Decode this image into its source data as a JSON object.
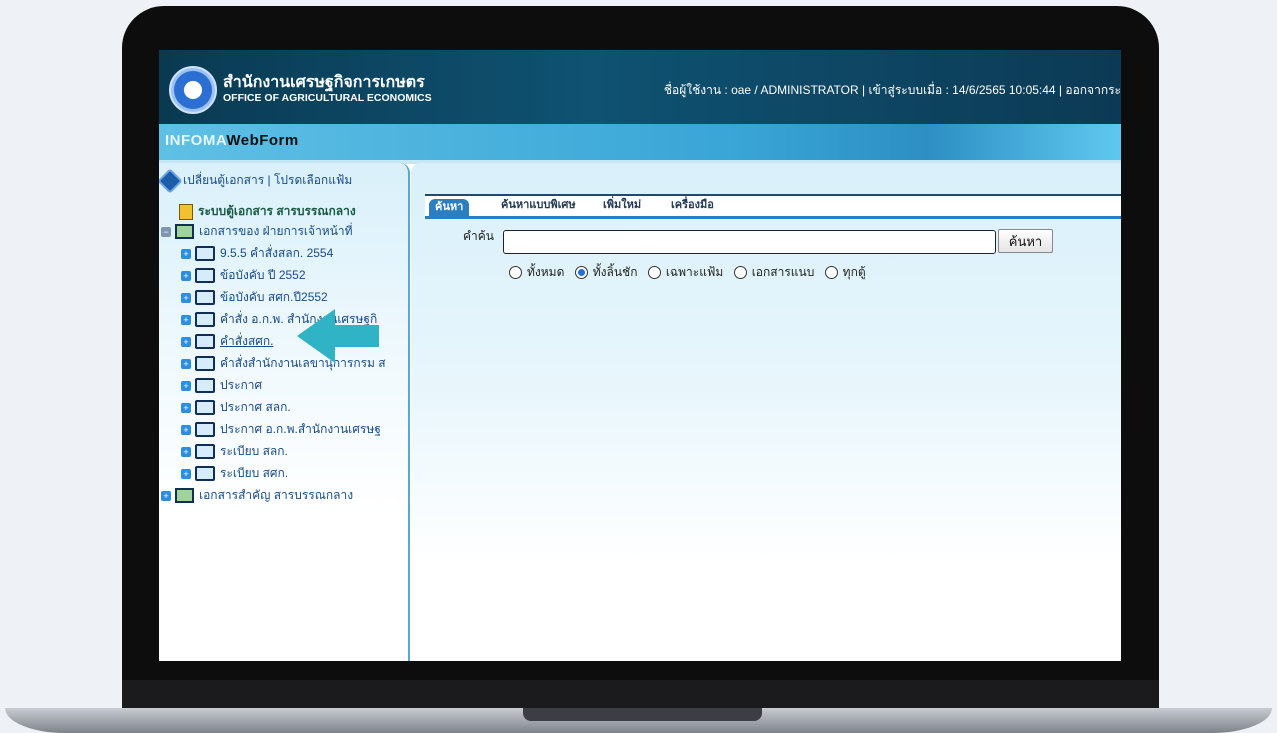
{
  "header": {
    "org_name_th": "สำนักงานเศรษฐกิจการเกษตร",
    "org_name_en": "OFFICE OF AGRICULTURAL ECONOMICS",
    "user_info": "ชื่อผู้ใช้งาน : oae / ADMINISTRATOR | เข้าสู่ระบบเมื่อ : 14/6/2565 10:05:44 | ออกจากระ"
  },
  "brand": {
    "part1": "INFOMA",
    "part2": "WebForm"
  },
  "sidebar": {
    "head": "เปลี่ยนตู้เอกสาร | โปรดเลือกแฟ้ม",
    "items": [
      {
        "label": "ระบบตู้เอกสาร สารบรรณกลาง"
      },
      {
        "label": "เอกสารของ ฝ่ายการเจ้าหน้าที่"
      },
      {
        "label": "9.5.5 คำสั่งสลก. 2554"
      },
      {
        "label": "ข้อบังคับ ปี 2552"
      },
      {
        "label": "ข้อบังคับ สศก.ปี2552"
      },
      {
        "label": "คำสั่ง อ.ก.พ. สำนักงานเศรษฐกิ"
      },
      {
        "label": "คำสั่งสศก."
      },
      {
        "label": "คำสั่งสำนักงานเลขานุการกรม ส"
      },
      {
        "label": "ประกาศ"
      },
      {
        "label": "ประกาศ สลก."
      },
      {
        "label": "ประกาศ อ.ก.พ.สำนักงานเศรษฐ"
      },
      {
        "label": "ระเบียบ สลก."
      },
      {
        "label": "ระเบียบ สศก."
      },
      {
        "label": "เอกสารสำคัญ สารบรรณกลาง"
      }
    ]
  },
  "tabs": [
    "ค้นหา",
    "ค้นหาแบบพิเศษ",
    "เพิ่มใหม่",
    "เครื่องมือ"
  ],
  "search": {
    "label": "คำค้น",
    "value": "",
    "button": "ค้นหา",
    "options": [
      "ทั้งหมด",
      "ทั้งลิ้นชัก",
      "เฉพาะแฟ้ม",
      "เอกสารแนบ",
      "ทุกตู้"
    ],
    "selected": "ทั้งลิ้นชัก"
  },
  "colors": {
    "accent": "#2b7ec0",
    "arrow": "#2fb3c5"
  }
}
